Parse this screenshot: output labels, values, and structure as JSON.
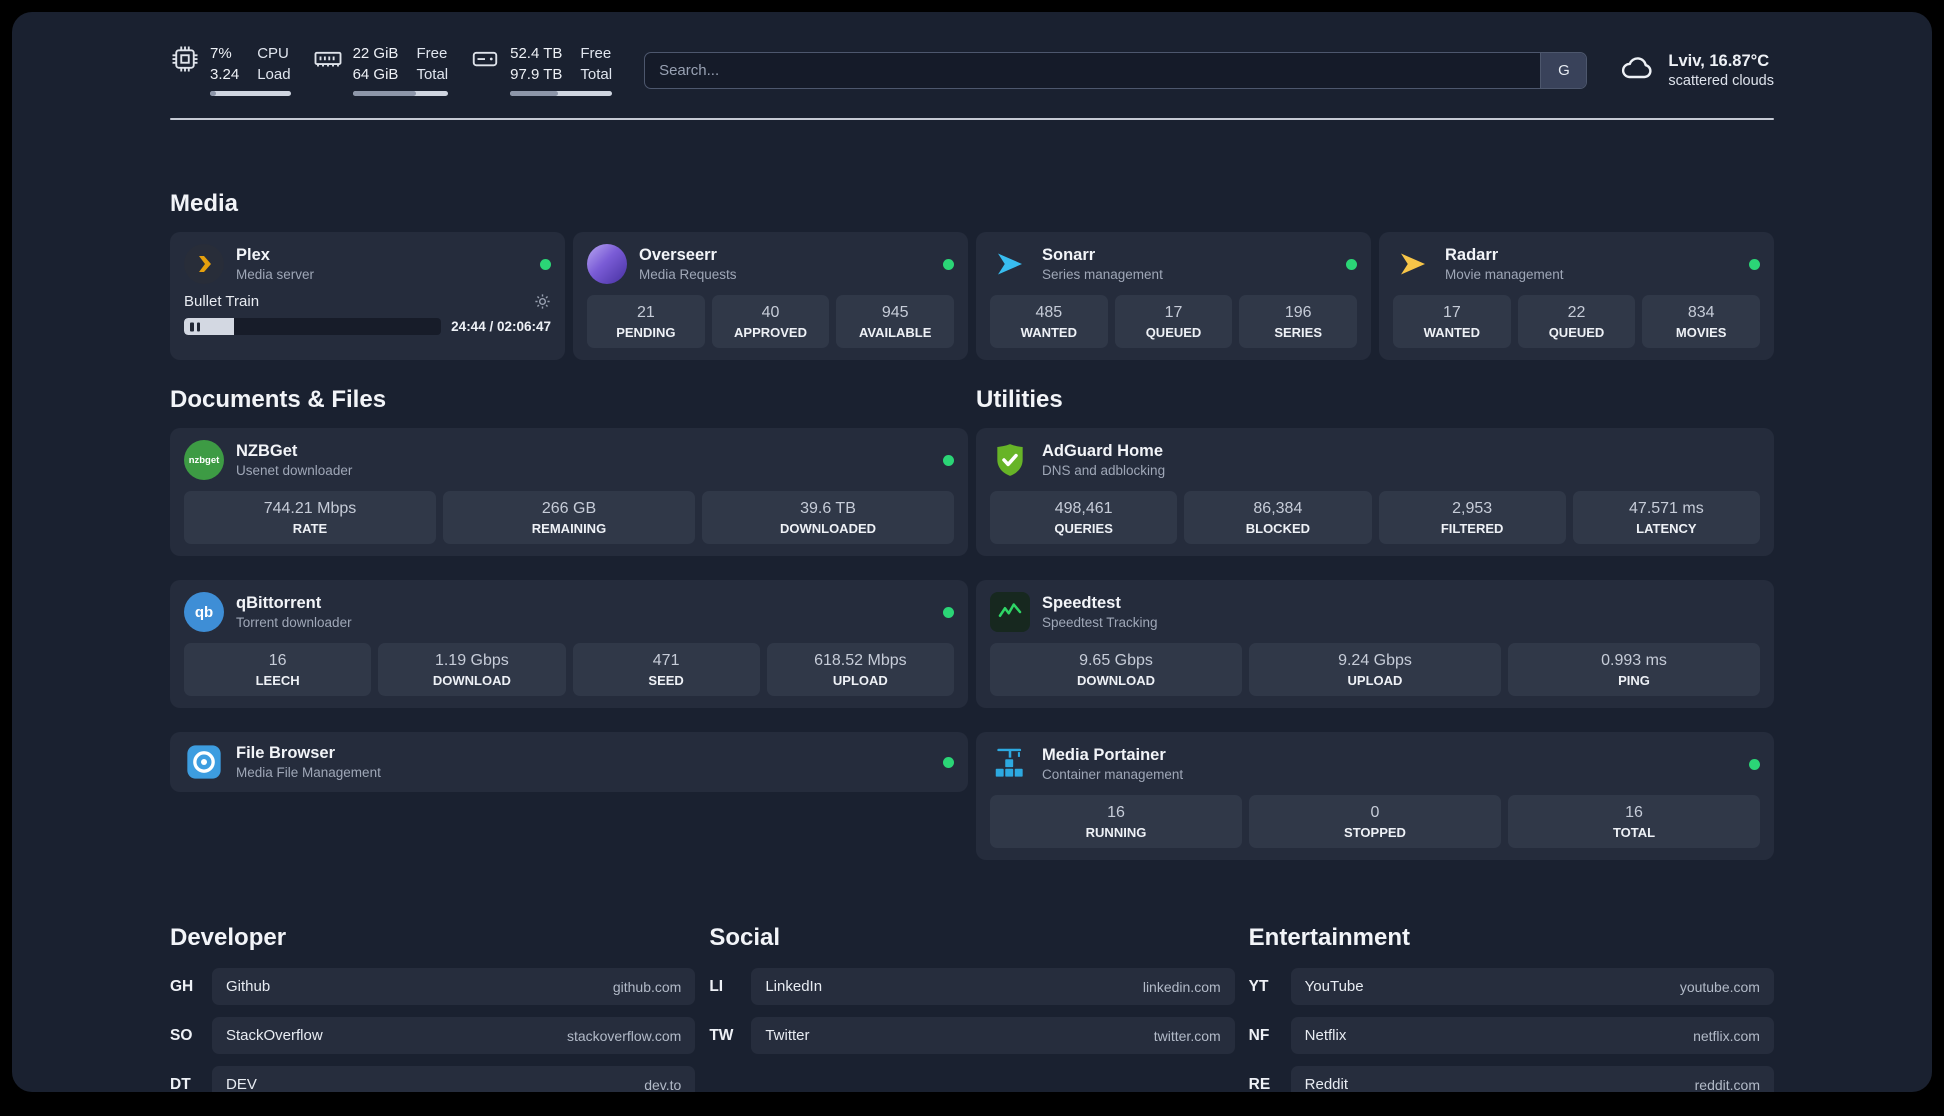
{
  "colors": {
    "status_online": "#2bd576",
    "panel_bg": "#1a2130",
    "card_bg": "#252c3c",
    "tile_bg": "#303848",
    "plex_amber": "#e5a00d",
    "sonarr_blue": "#38bdf0",
    "radarr_yellow": "#f7c548",
    "adguard_green": "#67b427"
  },
  "topbar": {
    "cpu": {
      "value_top": "7%",
      "value_bottom": "3.24",
      "label_top": "CPU",
      "label_bottom": "Load",
      "bar_width": "7%"
    },
    "ram": {
      "value_top": "22 GiB",
      "value_bottom": "64 GiB",
      "label_top": "Free",
      "label_bottom": "Total",
      "bar_width": "66%"
    },
    "disk": {
      "value_top": "52.4 TB",
      "value_bottom": "97.9 TB",
      "label_top": "Free",
      "label_bottom": "Total",
      "bar_width": "47%"
    },
    "search": {
      "placeholder": "Search...",
      "engine_label": "G"
    },
    "weather": {
      "location": "Lviv, 16.87°C",
      "condition": "scattered clouds"
    }
  },
  "sections": {
    "media": {
      "title": "Media",
      "plex": {
        "name": "Plex",
        "subtitle": "Media server",
        "now_playing": {
          "title": "Bullet Train",
          "time": "24:44 / 02:06:47",
          "progress_width": "19.5%"
        }
      },
      "overseerr": {
        "name": "Overseerr",
        "subtitle": "Media Requests",
        "stats": [
          {
            "value": "21",
            "label": "PENDING"
          },
          {
            "value": "40",
            "label": "APPROVED"
          },
          {
            "value": "945",
            "label": "AVAILABLE"
          }
        ]
      },
      "sonarr": {
        "name": "Sonarr",
        "subtitle": "Series management",
        "stats": [
          {
            "value": "485",
            "label": "WANTED"
          },
          {
            "value": "17",
            "label": "QUEUED"
          },
          {
            "value": "196",
            "label": "SERIES"
          }
        ]
      },
      "radarr": {
        "name": "Radarr",
        "subtitle": "Movie management",
        "stats": [
          {
            "value": "17",
            "label": "WANTED"
          },
          {
            "value": "22",
            "label": "QUEUED"
          },
          {
            "value": "834",
            "label": "MOVIES"
          }
        ]
      }
    },
    "documents": {
      "title": "Documents & Files",
      "nzbget": {
        "name": "NZBGet",
        "subtitle": "Usenet downloader",
        "icon_text": "nzbget",
        "stats": [
          {
            "value": "744.21 Mbps",
            "label": "RATE"
          },
          {
            "value": "266 GB",
            "label": "REMAINING"
          },
          {
            "value": "39.6 TB",
            "label": "DOWNLOADED"
          }
        ]
      },
      "qbittorrent": {
        "name": "qBittorrent",
        "subtitle": "Torrent downloader",
        "icon_text": "qb",
        "stats": [
          {
            "value": "16",
            "label": "LEECH"
          },
          {
            "value": "1.19 Gbps",
            "label": "DOWNLOAD"
          },
          {
            "value": "471",
            "label": "SEED"
          },
          {
            "value": "618.52 Mbps",
            "label": "UPLOAD"
          }
        ]
      },
      "filebrowser": {
        "name": "File Browser",
        "subtitle": "Media File Management"
      }
    },
    "utilities": {
      "title": "Utilities",
      "adguard": {
        "name": "AdGuard Home",
        "subtitle": "DNS and adblocking",
        "stats": [
          {
            "value": "498,461",
            "label": "QUERIES"
          },
          {
            "value": "86,384",
            "label": "BLOCKED"
          },
          {
            "value": "2,953",
            "label": "FILTERED"
          },
          {
            "value": "47.571 ms",
            "label": "LATENCY"
          }
        ]
      },
      "speedtest": {
        "name": "Speedtest",
        "subtitle": "Speedtest Tracking",
        "stats": [
          {
            "value": "9.65 Gbps",
            "label": "DOWNLOAD"
          },
          {
            "value": "9.24 Gbps",
            "label": "UPLOAD"
          },
          {
            "value": "0.993 ms",
            "label": "PING"
          }
        ]
      },
      "portainer": {
        "name": "Media Portainer",
        "subtitle": "Container management",
        "stats": [
          {
            "value": "16",
            "label": "RUNNING"
          },
          {
            "value": "0",
            "label": "STOPPED"
          },
          {
            "value": "16",
            "label": "TOTAL"
          }
        ]
      }
    },
    "bookmarks": [
      {
        "title": "Developer",
        "items": [
          {
            "code": "GH",
            "name": "Github",
            "url": "github.com"
          },
          {
            "code": "SO",
            "name": "StackOverflow",
            "url": "stackoverflow.com"
          },
          {
            "code": "DT",
            "name": "DEV",
            "url": "dev.to"
          }
        ]
      },
      {
        "title": "Social",
        "items": [
          {
            "code": "LI",
            "name": "LinkedIn",
            "url": "linkedin.com"
          },
          {
            "code": "TW",
            "name": "Twitter",
            "url": "twitter.com"
          }
        ]
      },
      {
        "title": "Entertainment",
        "items": [
          {
            "code": "YT",
            "name": "YouTube",
            "url": "youtube.com"
          },
          {
            "code": "NF",
            "name": "Netflix",
            "url": "netflix.com"
          },
          {
            "code": "RE",
            "name": "Reddit",
            "url": "reddit.com"
          }
        ]
      }
    ]
  }
}
